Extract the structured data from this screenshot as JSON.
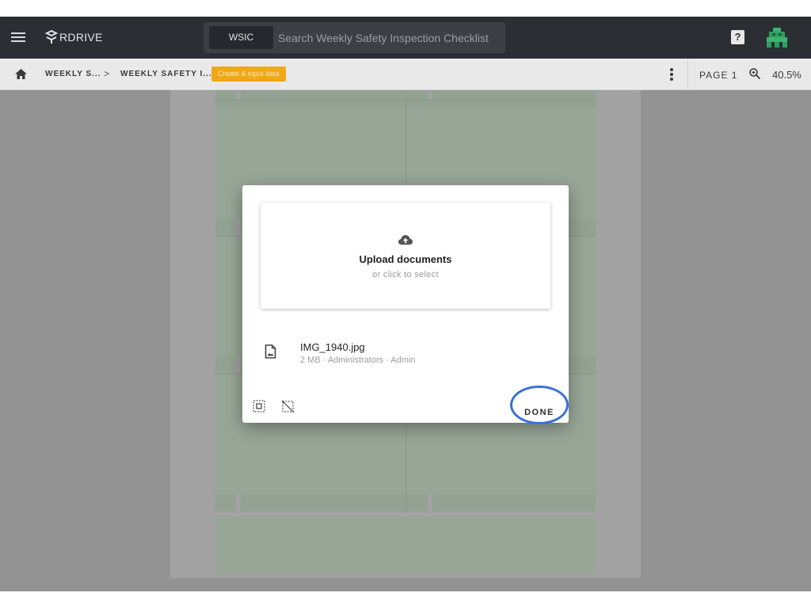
{
  "app": {
    "logo_text": "RDRIVE"
  },
  "search": {
    "scope_tag": "WSIC",
    "placeholder": "Search Weekly Safety Inspection Checklist"
  },
  "header": {
    "help_label": "?"
  },
  "toolbar": {
    "breadcrumb": [
      "WEEKLY S...",
      "WEEKLY SAFETY I..."
    ],
    "separator": ">",
    "action_label": "Create & input data",
    "page_label": "PAGE 1",
    "zoom": "40.5%"
  },
  "dialog": {
    "upload_title": "Upload documents",
    "upload_subtitle": "or click to select",
    "files": [
      {
        "name": "IMG_1940.jpg",
        "meta": "2 MB · Administrators · Admin"
      }
    ],
    "done_label": "DONE"
  },
  "icons": [
    "menu-icon",
    "logo-icon",
    "help-icon",
    "avatar-icon",
    "home-icon",
    "more-vert-icon",
    "zoom-icon",
    "cloud-upload-icon",
    "image-file-icon",
    "select-all-icon",
    "deselect-icon"
  ],
  "colors": {
    "appbar": "#2b2f33",
    "action_chip": "#f0a818",
    "done_highlight": "#3a6fd8"
  }
}
